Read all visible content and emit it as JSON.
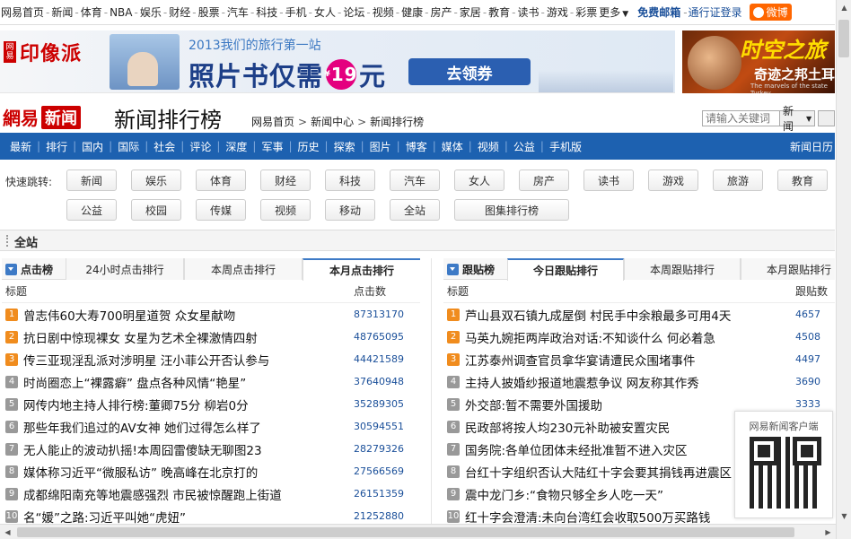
{
  "topnav": {
    "links": [
      "网易首页",
      "新闻",
      "体育",
      "NBA",
      "娱乐",
      "财经",
      "股票",
      "汽车",
      "科技",
      "手机",
      "女人",
      "论坛",
      "视频",
      "健康",
      "房产",
      "家居",
      "教育",
      "读书",
      "游戏",
      "彩票"
    ],
    "more": "更多",
    "mail": "免费邮箱",
    "login": "通行证登录",
    "weibo": "微博"
  },
  "banner": {
    "brand_tag": "网易",
    "brand": "印像派",
    "sub": "2013我们的旅行第一站",
    "main_pre": "照片书仅需",
    "price_currency": "¥",
    "price": "19",
    "main_post": "元",
    "cta": "去领券"
  },
  "ad2": {
    "t1": "时空之旅",
    "t2": "奇迹之邦土耳",
    "t3": "The marvels of the state Turkey"
  },
  "header": {
    "logo_wy": "網易",
    "logo_xw": "新闻",
    "title": "新闻排行榜",
    "breadcrumb": [
      "网易首页",
      "新闻中心",
      "新闻排行榜"
    ],
    "search_placeholder": "请输入关键词",
    "search_scope": "新闻"
  },
  "channel": {
    "items": [
      "最新",
      "排行",
      "国内",
      "国际",
      "社会",
      "评论",
      "深度",
      "军事",
      "历史",
      "探索",
      "图片",
      "博客",
      "媒体",
      "视频",
      "公益",
      "手机版"
    ],
    "calendar": "新闻日历"
  },
  "quick": {
    "label": "快速跳转:",
    "row1": [
      "新闻",
      "娱乐",
      "体育",
      "财经",
      "科技",
      "汽车",
      "女人",
      "房产",
      "读书",
      "游戏",
      "旅游",
      "教育"
    ],
    "row2": [
      "公益",
      "校园",
      "传媒",
      "视频",
      "移动",
      "全站"
    ],
    "row2_wide": "图集排行榜"
  },
  "section_title": "全站",
  "left_panel": {
    "title": "点击榜",
    "tabs": [
      "24小时点击排行",
      "本周点击排行",
      "本月点击排行"
    ],
    "col_title": "标题",
    "col_count": "点击数",
    "rows": [
      {
        "n": "1",
        "title": "曾志伟60大寿700明星道贺 众女星献吻",
        "count": "87313170"
      },
      {
        "n": "2",
        "title": "抗日剧中惊现裸女 女星为艺术全裸激情四射",
        "count": "48765095"
      },
      {
        "n": "3",
        "title": "传三亚现淫乱派对涉明星 汪小菲公开否认参与",
        "count": "44421589"
      },
      {
        "n": "4",
        "title": "时尚圈恋上“裸露癖” 盘点各种风情“艳星”",
        "count": "37640948"
      },
      {
        "n": "5",
        "title": "网传内地主持人排行榜:董卿75分 柳岩0分",
        "count": "35289305"
      },
      {
        "n": "6",
        "title": "那些年我们追过的AV女神 她们过得怎么样了",
        "count": "30594551"
      },
      {
        "n": "7",
        "title": "无人能止的波动扒摇!本周囧雷傻缺无聊图23",
        "count": "28279326"
      },
      {
        "n": "8",
        "title": "媒体称习近平“微服私访” 晚高峰在北京打的",
        "count": "27566569"
      },
      {
        "n": "9",
        "title": "成都绵阳南充等地震感强烈 市民被惊醒跑上街道",
        "count": "26151359"
      },
      {
        "n": "10",
        "title": "名“媛”之路:习近平叫她“虎妞”",
        "count": "21252880"
      }
    ]
  },
  "right_panel": {
    "title": "跟贴榜",
    "tabs": [
      "今日跟贴排行",
      "本周跟贴排行",
      "本月跟贴排行"
    ],
    "col_title": "标题",
    "col_count": "跟贴数",
    "rows": [
      {
        "n": "1",
        "title": "芦山县双石镇九成屋倒 村民手中余粮最多可用4天",
        "count": "4657"
      },
      {
        "n": "2",
        "title": "马英九婉拒两岸政治对话:不知谈什么 何必着急",
        "count": "4508"
      },
      {
        "n": "3",
        "title": "江苏泰州调查官员拿华宴请遭民众围堵事件",
        "count": "4497"
      },
      {
        "n": "4",
        "title": "主持人披婚纱报道地震惹争议 网友称其作秀",
        "count": "3690"
      },
      {
        "n": "5",
        "title": "外交部:暂不需要外国援助",
        "count": "3333"
      },
      {
        "n": "6",
        "title": "民政部将按人均230元补助被安置灾民",
        "count": ""
      },
      {
        "n": "7",
        "title": "国务院:各单位团体未经批准暂不进入灾区",
        "count": ""
      },
      {
        "n": "8",
        "title": "台红十字组织否认大陆红十字会要其捐钱再进震区",
        "count": ""
      },
      {
        "n": "9",
        "title": "震中龙门乡:“食物只够全乡人吃一天”",
        "count": ""
      },
      {
        "n": "10",
        "title": "红十字会澄清:未向台湾红会收取500万买路钱",
        "count": ""
      }
    ]
  },
  "qr": {
    "title": "网易新闻客户端"
  },
  "colors": {
    "accent": "#1d61b0",
    "brand_red": "#cc0000",
    "rank_top": "#f08c1e"
  }
}
